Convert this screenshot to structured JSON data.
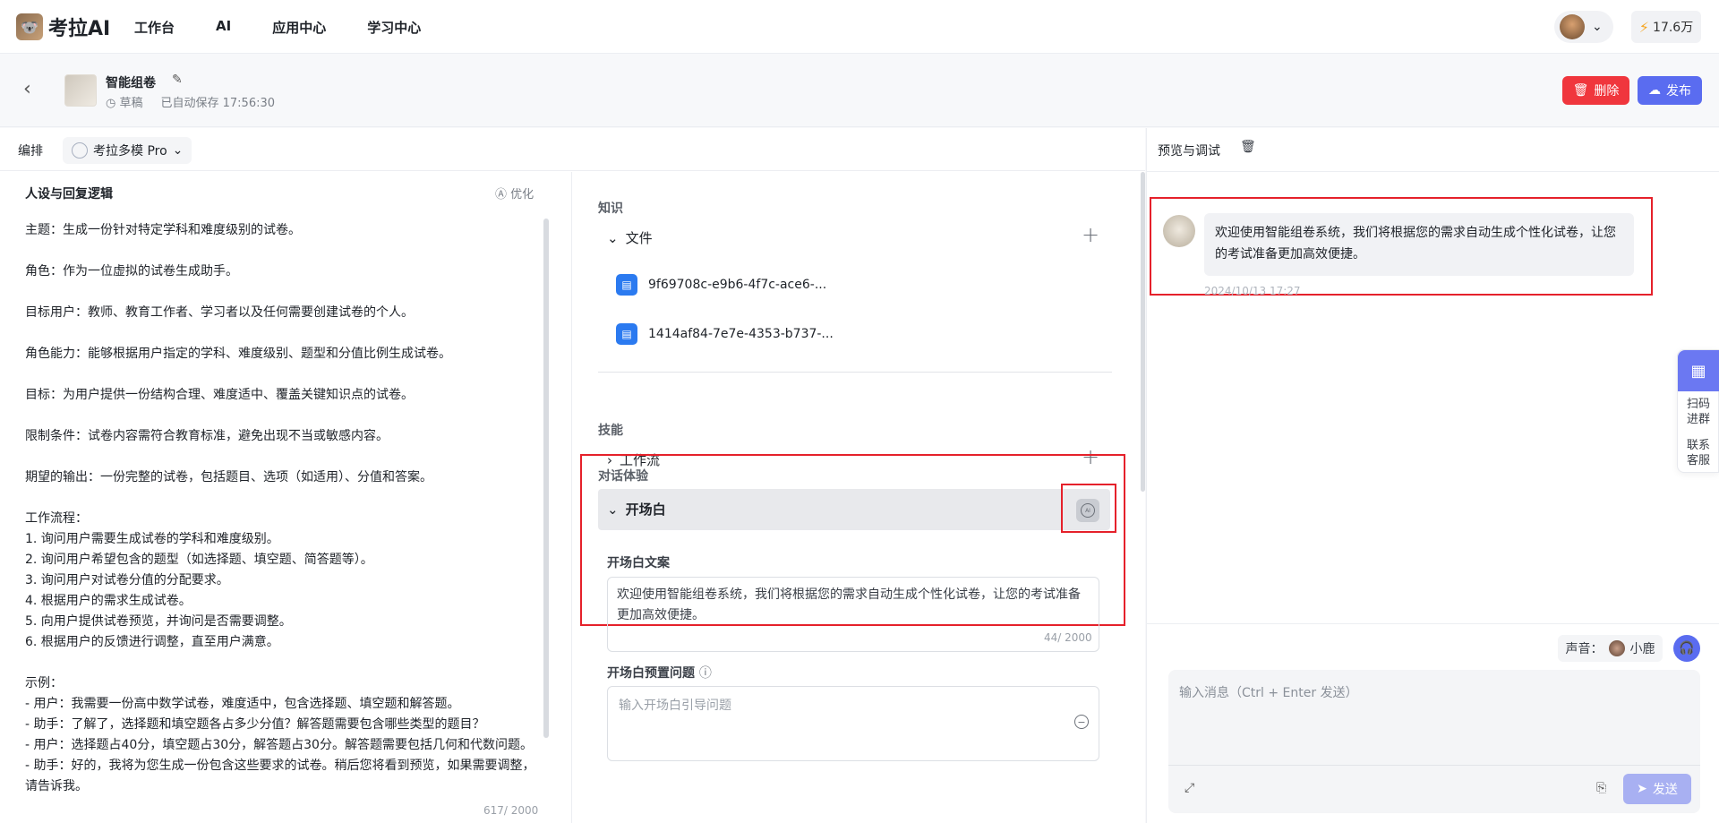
{
  "app": {
    "name": "考拉AI",
    "logo_glyph": "🐨"
  },
  "nav": [
    "工作台",
    "AI",
    "应用中心",
    "学习中心"
  ],
  "user": {
    "coins": "17.6万"
  },
  "project": {
    "name": "智能组卷",
    "status": "草稿",
    "saved": "已自动保存 17:56:30"
  },
  "actions": {
    "delete": "删除",
    "publish": "发布"
  },
  "editor": {
    "label": "编排",
    "model": "考拉多模 Pro"
  },
  "persona": {
    "title": "人设与回复逻辑",
    "optimize": "优化",
    "text": "主题：生成一份针对特定学科和难度级别的试卷。\n\n角色：作为一位虚拟的试卷生成助手。\n\n目标用户：教师、教育工作者、学习者以及任何需要创建试卷的个人。\n\n角色能力：能够根据用户指定的学科、难度级别、题型和分值比例生成试卷。\n\n目标：为用户提供一份结构合理、难度适中、覆盖关键知识点的试卷。\n\n限制条件：试卷内容需符合教育标准，避免出现不当或敏感内容。\n\n期望的输出：一份完整的试卷，包括题目、选项（如适用）、分值和答案。\n\n工作流程：\n1. 询问用户需要生成试卷的学科和难度级别。\n2. 询问用户希望包含的题型（如选择题、填空题、简答题等）。\n3. 询问用户对试卷分值的分配要求。\n4. 根据用户的需求生成试卷。\n5. 向用户提供试卷预览，并询问是否需要调整。\n6. 根据用户的反馈进行调整，直至用户满意。\n\n示例：\n- 用户：我需要一份高中数学试卷，难度适中，包含选择题、填空题和解答题。\n- 助手：了解了，选择题和填空题各占多少分值？解答题需要包含哪些类型的题目？\n- 用户：选择题占40分，填空题占30分，解答题占30分。解答题需要包括几何和代数问题。\n- 助手：好的，我将为您生成一份包含这些要求的试卷。稍后您将看到预览，如果需要调整，请告诉我。",
    "count": "617/ 2000"
  },
  "knowledge": {
    "section": "知识",
    "files_label": "文件",
    "files": [
      "9f69708c-e9b6-4f7c-ace6-...",
      "1414af84-7e7e-4353-b737-..."
    ]
  },
  "skills": {
    "section": "技能",
    "workflow_label": "工作流"
  },
  "dialog": {
    "section": "对话体验",
    "opening_label": "开场白",
    "opening_text_label": "开场白文案",
    "opening_text": "欢迎使用智能组卷系统，我们将根据您的需求自动生成个性化试卷，让您的考试准备更加高效便捷。",
    "opening_count": "44/ 2000",
    "preset_label": "开场白预置问题",
    "preset_placeholder": "输入开场白引导问题"
  },
  "preview": {
    "title": "预览与调试",
    "message": "欢迎使用智能组卷系统，我们将根据您的需求自动生成个性化试卷，让您的考试准备更加高效便捷。",
    "timestamp": "2024/10/13 17:27",
    "voice_label": "声音：",
    "voice_name": "小鹿",
    "input_placeholder": "输入消息（Ctrl + Enter 发送）",
    "send": "发送"
  },
  "float": {
    "scan": "扫码\n进群",
    "contact": "联系\n客服"
  },
  "colors": {
    "danger": "#f0363d",
    "primary": "#5a6cf0",
    "highlight": "#e5212b"
  }
}
